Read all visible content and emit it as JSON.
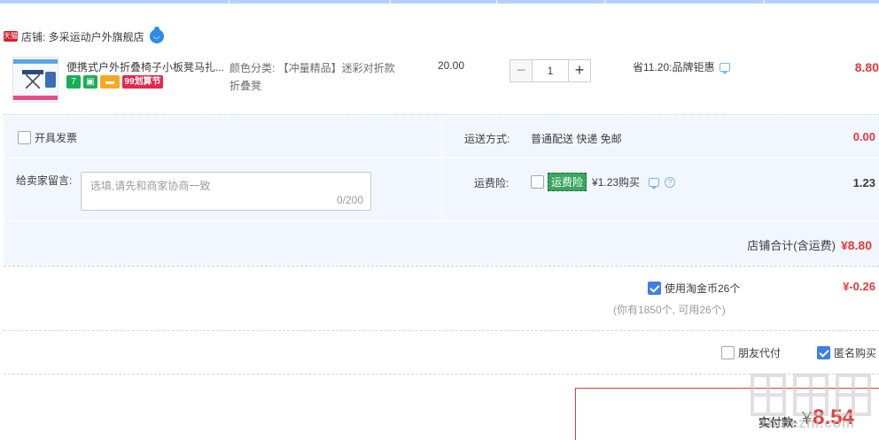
{
  "shop": {
    "badge": "天猫",
    "label": "店铺: 多采运动户外旗舰店"
  },
  "item": {
    "title": "便携式户外折叠椅子小板凳马扎...",
    "promo_icons": [
      "7",
      "",
      "",
      "99划算节"
    ],
    "sku_label": "颜色分类: 【冲量精品】迷彩对折款折叠凳",
    "price": "20.00",
    "quantity": "1",
    "minus": "−",
    "plus": "+",
    "saving": "省11.20:品牌钜惠",
    "subtotal": "8.80"
  },
  "options": {
    "invoice": "开具发票",
    "ship_label": "运送方式:",
    "ship_value": "普通配送 快递 免邮",
    "ship_price": "0.00",
    "msg_label": "给卖家留言:",
    "msg_placeholder": "选填,请先和商家协商一致",
    "msg_count": "0/200",
    "ins_label": "运费险:",
    "ins_tag": "运费险",
    "ins_text": "¥1.23购买",
    "ins_price": "1.23",
    "shop_total_label": "店铺合计(含运费)",
    "shop_total_value": "¥8.80"
  },
  "coins": {
    "label": "使用淘金币26个",
    "note": "(你有1850个, 可用26个)",
    "value": "¥-0.26"
  },
  "extras": {
    "friend": "朋友代付",
    "anon": "匿名购买"
  },
  "pay": {
    "label": "实付款:",
    "currency": "¥",
    "amount": "8.54"
  },
  "watermark": {
    "text": "zhidezhi.com"
  },
  "colors": {
    "accent_red": "#e4393c",
    "accent_blue": "#3d7ee8",
    "panel_bg": "#f2f7ff"
  }
}
